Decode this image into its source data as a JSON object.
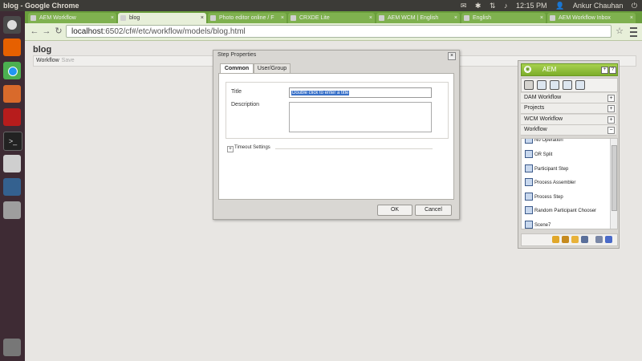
{
  "os": {
    "window_title": "blog - Google Chrome",
    "clock": "12:15 PM",
    "user": "Ankur Chauhan"
  },
  "browser": {
    "tabs": [
      {
        "label": "AEM Workflow"
      },
      {
        "label": "blog"
      },
      {
        "label": "Photo editor online / F"
      },
      {
        "label": "CRXDE Lite"
      },
      {
        "label": "AEM WCM | English"
      },
      {
        "label": "English"
      },
      {
        "label": "AEM Workflow Inbox"
      }
    ],
    "url_host": "localhost",
    "url_rest": ":6502/cf#/etc/workflow/models/blog.html"
  },
  "page": {
    "title": "blog",
    "toolbar": {
      "workflow": "Workflow",
      "save": "Save"
    }
  },
  "dialog": {
    "title": "Step Properties",
    "tabs": [
      "Common",
      "User/Group"
    ],
    "title_label": "Title",
    "title_value": "Double click to enter a title",
    "description_label": "Description",
    "timeout_label": "Timeout Settings",
    "ok": "OK",
    "cancel": "Cancel"
  },
  "sidekick": {
    "title": "AEM",
    "groups": [
      "DAM Workflow",
      "Projects",
      "WCM Workflow",
      "Workflow"
    ],
    "items": [
      "No Operation",
      "OR Split",
      "Participant Step",
      "Process Assembler",
      "Process Step",
      "Random Participant Chooser",
      "Scene7"
    ]
  }
}
